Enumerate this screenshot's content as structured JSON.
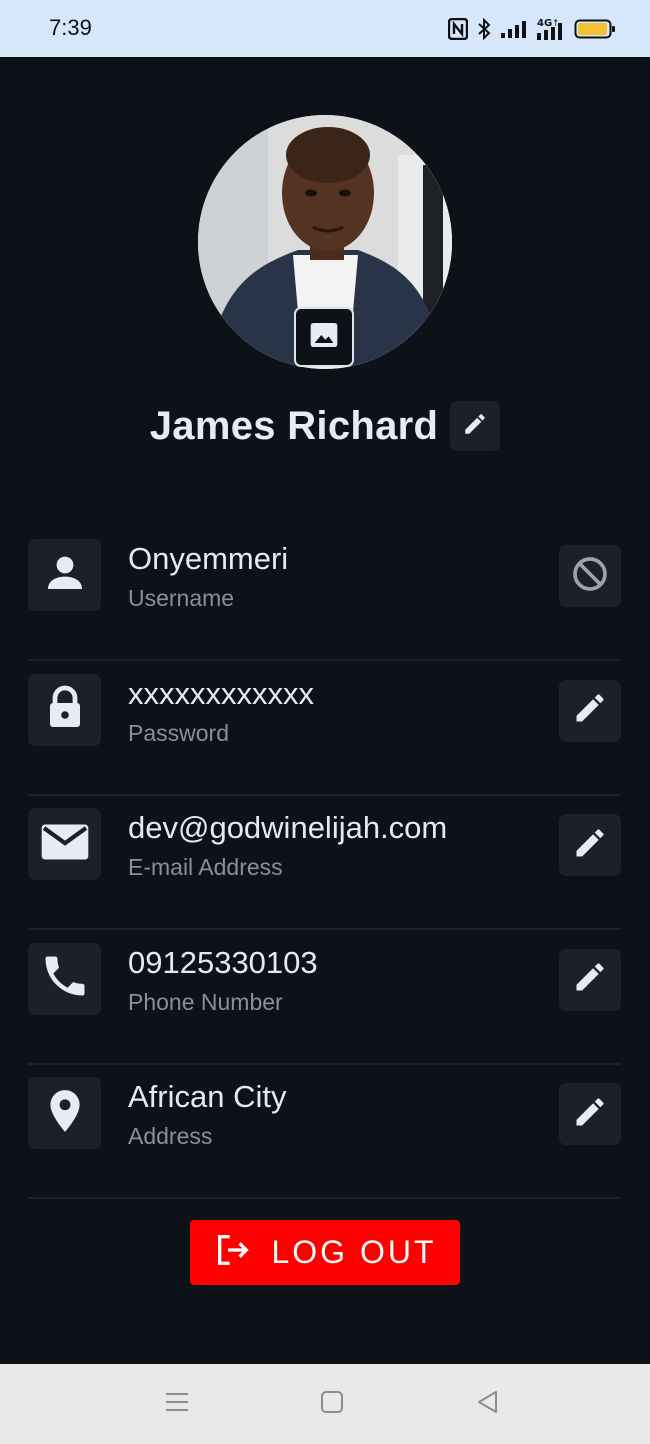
{
  "status_bar": {
    "time": "7:39",
    "icons": [
      "nfc-icon",
      "bluetooth-icon",
      "signal-icon",
      "4g-signal-icon",
      "battery-icon"
    ],
    "network_label": "4G"
  },
  "profile": {
    "name": "James Richard",
    "avatar_icon": "profile-photo",
    "change_photo_icon": "image-icon",
    "edit_name_icon": "pencil-icon"
  },
  "info_rows": [
    {
      "value": "Onyemmeri",
      "label": "Username",
      "icon": "person-icon",
      "action_icon": "blocked-icon"
    },
    {
      "value": "xxxxxxxxxxxx",
      "label": "Password",
      "icon": "lock-icon",
      "action_icon": "pencil-icon"
    },
    {
      "value": "dev@godwinelijah.com",
      "label": "E-mail Address",
      "icon": "mail-icon",
      "action_icon": "pencil-icon"
    },
    {
      "value": "09125330103",
      "label": "Phone Number",
      "icon": "phone-icon",
      "action_icon": "pencil-icon"
    },
    {
      "value": "African City",
      "label": "Address",
      "icon": "location-pin-icon",
      "action_icon": "pencil-icon"
    }
  ],
  "logout": {
    "label": "LOG OUT",
    "icon": "logout-icon",
    "color": "#fd0000"
  },
  "nav_bar": {
    "icons": [
      "menu-icon",
      "home-square-icon",
      "back-triangle-icon"
    ]
  },
  "colors": {
    "background": "#0d1118",
    "card": "#1b202a",
    "text_primary": "#e4eaf4",
    "text_secondary": "#8a8f98",
    "status_bar": "#d6e6fb",
    "accent_red": "#fd0000"
  }
}
